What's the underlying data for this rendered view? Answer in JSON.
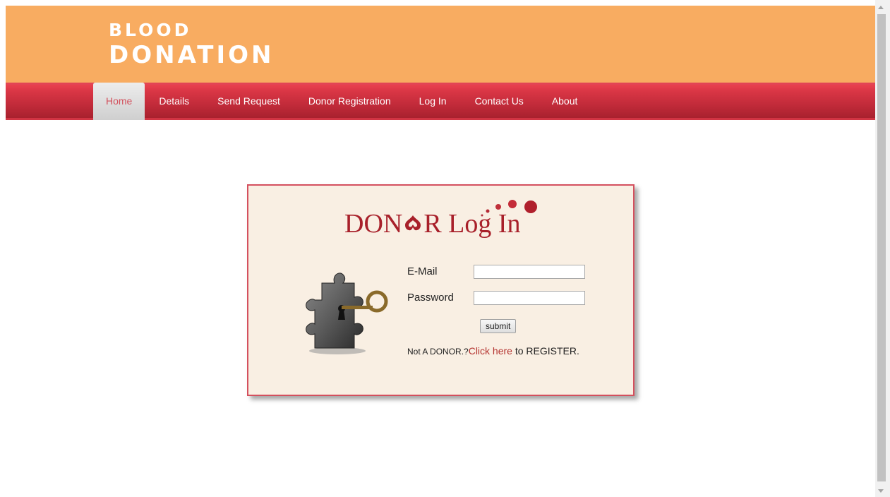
{
  "header": {
    "logo_line1": "Blood",
    "logo_line2": "Donation"
  },
  "nav": {
    "items": [
      {
        "label": "Home"
      },
      {
        "label": "Details"
      },
      {
        "label": "Send Request"
      },
      {
        "label": "Donor Registration"
      },
      {
        "label": "Log In"
      },
      {
        "label": "Contact Us"
      },
      {
        "label": "About"
      }
    ],
    "active_index": 0
  },
  "login": {
    "title_part1": "DON",
    "title_part2": "R Log In",
    "email_label": "E-Mail",
    "email_value": "",
    "password_label": "Password",
    "password_value": "",
    "submit_label": "submit",
    "register_prefix": "Not A DONOR.?",
    "register_link": "Click here",
    "register_suffix": " to REGISTER."
  },
  "colors": {
    "header_bg": "#f8ac61",
    "nav_bg": "#c22b3a",
    "accent_red": "#a8202a",
    "login_bg": "#f9efe3"
  }
}
